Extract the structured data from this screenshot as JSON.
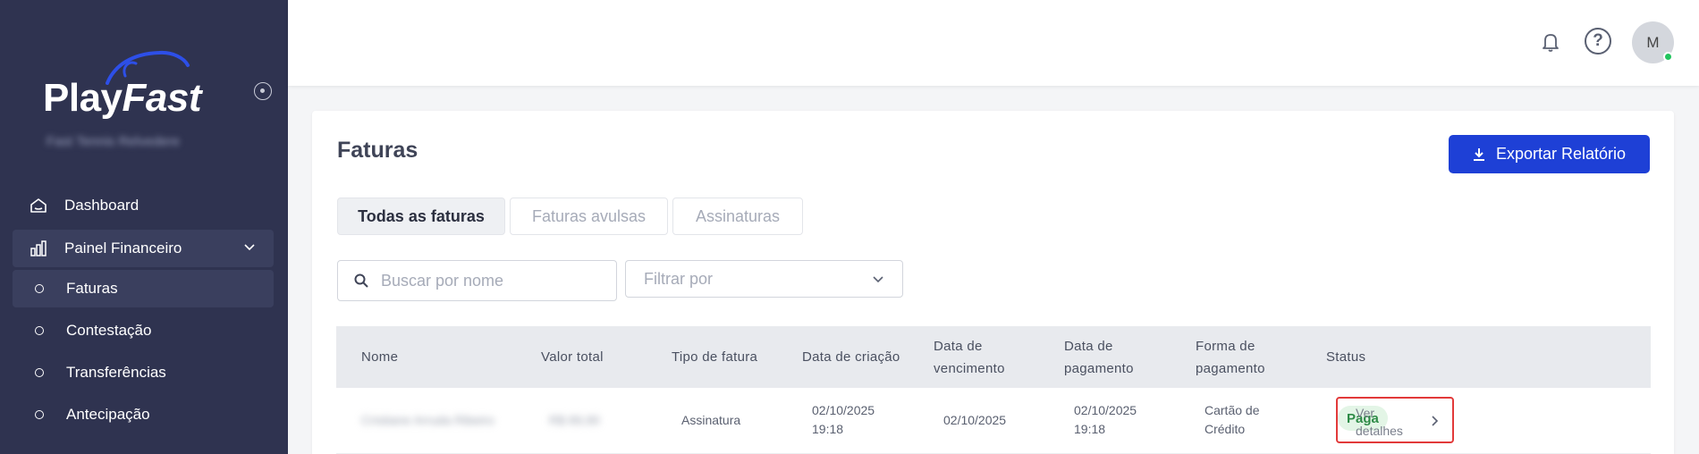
{
  "brand": {
    "name_part1": "Play",
    "name_part2": "Fast",
    "org_name": "Fast Tennis Relvedere"
  },
  "sidebar": {
    "items": [
      {
        "label": "Dashboard",
        "icon": "home-icon"
      },
      {
        "label": "Painel Financeiro",
        "icon": "chart-bars-icon"
      },
      {
        "label": "Faturas"
      },
      {
        "label": "Contestação"
      },
      {
        "label": "Transferências"
      },
      {
        "label": "Antecipação"
      }
    ]
  },
  "header": {
    "avatar_initial": "M"
  },
  "main": {
    "title": "Faturas",
    "export_label": "Exportar Relatório",
    "tabs": [
      {
        "label": "Todas as faturas"
      },
      {
        "label": "Faturas avulsas"
      },
      {
        "label": "Assinaturas"
      }
    ],
    "search": {
      "placeholder": "Buscar por nome"
    },
    "filter": {
      "placeholder": "Filtrar por"
    },
    "table": {
      "headers": {
        "name": "Nome",
        "total": "Valor total",
        "type": "Tipo de fatura",
        "created_1": "Data de criação",
        "due_1": "Data de",
        "due_2": "vencimento",
        "paid_1": "Data de",
        "paid_2": "pagamento",
        "method_1": "Forma de",
        "method_2": "pagamento",
        "status": "Status"
      },
      "rows": [
        {
          "name": "Cristiane Arruda Ribeiro",
          "total": "R$ 89,90",
          "type": "Assinatura",
          "created_date": "02/10/2025",
          "created_time": "19:18",
          "due": "02/10/2025",
          "paid_date": "02/10/2025",
          "paid_time": "19:18",
          "method_1": "Cartão de",
          "method_2": "Crédito",
          "status": "Paga",
          "action_1": "Ver",
          "action_2": "detalhes"
        }
      ]
    }
  },
  "colors": {
    "sidebar_bg": "#2f3350",
    "primary": "#1e40d6",
    "success": "#2e8b47",
    "highlight": "#e23a3a"
  }
}
